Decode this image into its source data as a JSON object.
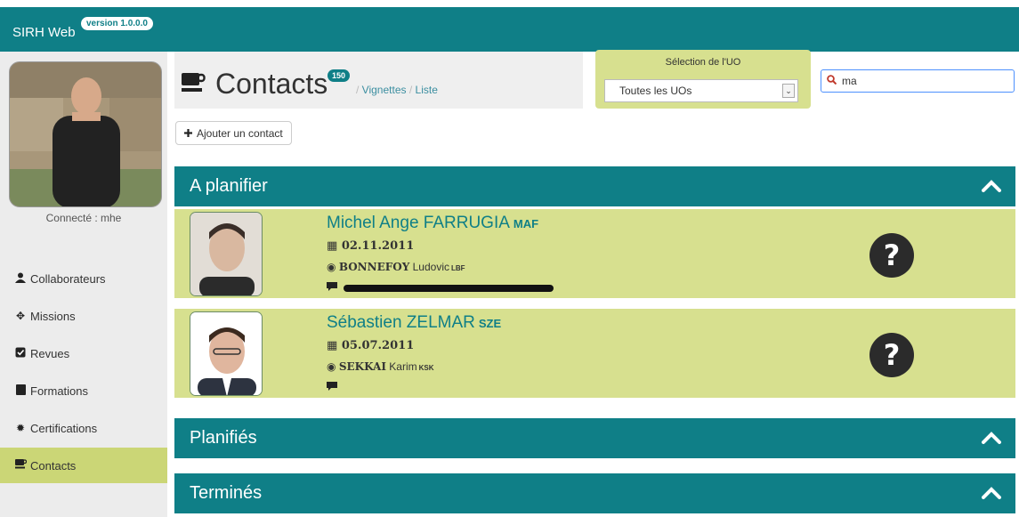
{
  "app": {
    "title": "SIRH Web",
    "version": "version 1.0.0.0"
  },
  "sidebar": {
    "connected": "Connecté : mhe",
    "items": [
      {
        "label": "Collaborateurs",
        "icon": "user-icon"
      },
      {
        "label": "Missions",
        "icon": "move-icon"
      },
      {
        "label": "Revues",
        "icon": "check-square-icon"
      },
      {
        "label": "Formations",
        "icon": "book-icon"
      },
      {
        "label": "Certifications",
        "icon": "certificate-icon"
      },
      {
        "label": "Contacts",
        "icon": "coffee-icon",
        "active": true
      }
    ]
  },
  "header": {
    "title": "Contacts",
    "count": "150",
    "breadcrumb": [
      "Vignettes",
      "Liste"
    ],
    "add_button": "Ajouter un contact"
  },
  "uo": {
    "label": "Sélection de l'UO",
    "selected": "Toutes les UOs"
  },
  "search": {
    "value": "ma"
  },
  "sections": [
    {
      "title": "A planifier"
    },
    {
      "title": "Planifiés"
    },
    {
      "title": "Terminés"
    }
  ],
  "contacts": [
    {
      "name": "Michel Ange FARRUGIA",
      "code": "MAF",
      "date": "02.11.2011",
      "responsible": "BONNEFOY",
      "responsible_first": "Ludovic",
      "responsible_code": "LBF"
    },
    {
      "name": "Sébastien ZELMAR",
      "code": "SZE",
      "date": "05.07.2011",
      "responsible": "SEKKAI",
      "responsible_first": "Karim",
      "responsible_code": "KSK"
    }
  ],
  "colors": {
    "primary": "#0f7f87",
    "accent": "#d7e08f",
    "active_nav": "#cbd676"
  }
}
